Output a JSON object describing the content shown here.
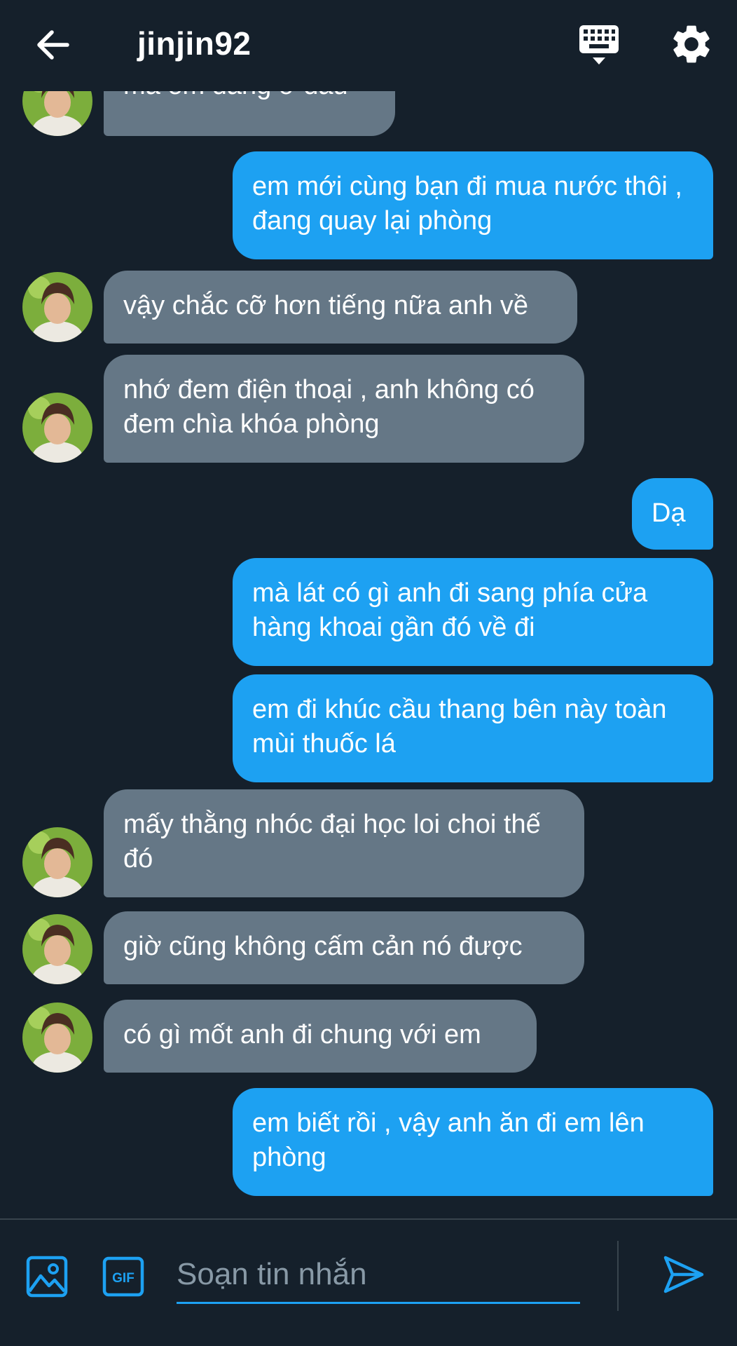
{
  "header": {
    "title": "jinjin92",
    "back_icon": "arrow-left-icon",
    "keyboard_icon": "keyboard-icon",
    "settings_icon": "gear-icon"
  },
  "colors": {
    "background": "#15202b",
    "sent_bubble": "#1da1f2",
    "received_bubble": "#657786",
    "accent": "#1da1f2"
  },
  "messages": [
    {
      "side": "received",
      "text": "mà em đang ở đâu",
      "avatar": true
    },
    {
      "side": "sent",
      "text": "em mới cùng bạn đi mua nước thôi , đang quay lại phòng"
    },
    {
      "side": "received",
      "text": "vậy chắc cỡ hơn tiếng nữa anh về",
      "avatar": true
    },
    {
      "side": "received",
      "text": "nhớ đem điện thoại , anh không có đem chìa khóa phòng",
      "avatar": true
    },
    {
      "side": "sent",
      "text": "Dạ"
    },
    {
      "side": "sent",
      "text": "mà lát có gì anh đi sang phía cửa hàng khoai gần đó về đi"
    },
    {
      "side": "sent",
      "text": "em đi khúc cầu thang bên này toàn mùi thuốc lá"
    },
    {
      "side": "received",
      "text": "mấy thằng nhóc đại học loi choi thế đó",
      "avatar": true
    },
    {
      "side": "received",
      "text": "giờ cũng không cấm cản nó được",
      "avatar": true
    },
    {
      "side": "received",
      "text": "có gì mốt anh đi chung với em",
      "avatar": true
    },
    {
      "side": "sent",
      "text": "em biết rồi , vậy anh ăn đi em lên phòng"
    }
  ],
  "composer": {
    "placeholder": "Soạn tin nhắn",
    "value": "",
    "image_icon": "image-icon",
    "gif_icon": "gif-icon",
    "send_icon": "send-icon"
  }
}
